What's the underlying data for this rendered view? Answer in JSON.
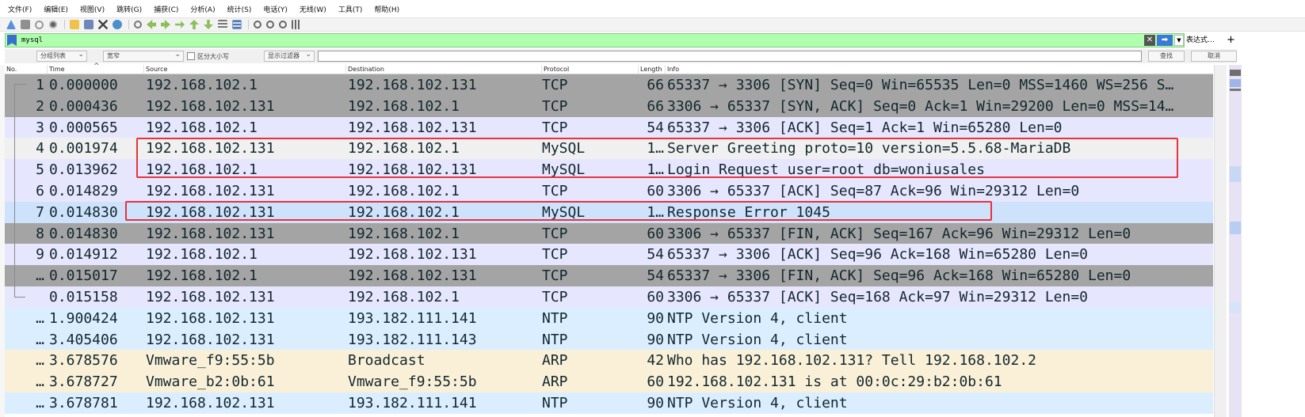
{
  "menu": [
    "文件(F)",
    "编辑(E)",
    "视图(V)",
    "跳转(G)",
    "捕获(C)",
    "分析(A)",
    "统计(S)",
    "电话(Y)",
    "无线(W)",
    "工具(T)",
    "帮助(H)"
  ],
  "filter": {
    "value": "mysql",
    "clear_icon": "✕",
    "apply_icon": "➡",
    "expression_label": "表达式…",
    "plus_label": "+"
  },
  "find": {
    "search_in": "分组列表",
    "string_type": "宽窄",
    "case_label": "区分大小写",
    "mode": "显示过滤器",
    "find_button": "查找",
    "cancel_button": "取消"
  },
  "columns": {
    "no": "No.",
    "time": "Time",
    "source": "Source",
    "destination": "Destination",
    "protocol": "Protocol",
    "length": "Length",
    "info": "Info",
    "sort_caret": "^"
  },
  "packets": [
    {
      "no": "1",
      "time": "0.000000",
      "source": "192.168.102.1",
      "destination": "192.168.102.131",
      "protocol": "TCP",
      "length": "66",
      "info": "65337 → 3306 [SYN] Seq=0 Win=65535 Len=0 MSS=1460 WS=256 S…",
      "bg": "#a4a4a4"
    },
    {
      "no": "2",
      "time": "0.000436",
      "source": "192.168.102.131",
      "destination": "192.168.102.1",
      "protocol": "TCP",
      "length": "66",
      "info": "3306 → 65337 [SYN, ACK] Seq=0 Ack=1 Win=29200 Len=0 MSS=14…",
      "bg": "#a4a4a4"
    },
    {
      "no": "3",
      "time": "0.000565",
      "source": "192.168.102.1",
      "destination": "192.168.102.131",
      "protocol": "TCP",
      "length": "54",
      "info": "65337 → 3306 [ACK] Seq=1 Ack=1 Win=65280 Len=0",
      "bg": "#e7e6ff"
    },
    {
      "no": "4",
      "time": "0.001974",
      "source": "192.168.102.131",
      "destination": "192.168.102.1",
      "protocol": "MySQL",
      "length": "1…",
      "info": "Server Greeting proto=10 version=5.5.68-MariaDB",
      "bg": "#f0f0f0"
    },
    {
      "no": "5",
      "time": "0.013962",
      "source": "192.168.102.1",
      "destination": "192.168.102.131",
      "protocol": "MySQL",
      "length": "1…",
      "info": "Login Request user=root db=woniusales",
      "bg": "#e7e6ff"
    },
    {
      "no": "6",
      "time": "0.014829",
      "source": "192.168.102.131",
      "destination": "192.168.102.1",
      "protocol": "TCP",
      "length": "60",
      "info": "3306 → 65337 [ACK] Seq=87 Ack=96 Win=29312 Len=0",
      "bg": "#e7e6ff"
    },
    {
      "no": "7",
      "time": "0.014830",
      "source": "192.168.102.131",
      "destination": "192.168.102.1",
      "protocol": "MySQL",
      "length": "1…",
      "info": "Response Error 1045",
      "bg": "#cfe2fb"
    },
    {
      "no": "8",
      "time": "0.014830",
      "source": "192.168.102.131",
      "destination": "192.168.102.1",
      "protocol": "TCP",
      "length": "60",
      "info": "3306 → 65337 [FIN, ACK] Seq=167 Ack=96 Win=29312 Len=0",
      "bg": "#a4a4a4"
    },
    {
      "no": "9",
      "time": "0.014912",
      "source": "192.168.102.1",
      "destination": "192.168.102.131",
      "protocol": "TCP",
      "length": "54",
      "info": "65337 → 3306 [ACK] Seq=96 Ack=168 Win=65280 Len=0",
      "bg": "#e7e6ff"
    },
    {
      "no": "…",
      "time": "0.015017",
      "source": "192.168.102.1",
      "destination": "192.168.102.131",
      "protocol": "TCP",
      "length": "54",
      "info": "65337 → 3306 [FIN, ACK] Seq=96 Ack=168 Win=65280 Len=0",
      "bg": "#a4a4a4"
    },
    {
      "no": "",
      "time": "0.015158",
      "source": "192.168.102.131",
      "destination": "192.168.102.1",
      "protocol": "TCP",
      "length": "60",
      "info": "3306 → 65337 [ACK] Seq=168 Ack=97 Win=29312 Len=0",
      "bg": "#e7e6ff"
    },
    {
      "no": "…",
      "time": "1.900424",
      "source": "192.168.102.131",
      "destination": "193.182.111.141",
      "protocol": "NTP",
      "length": "90",
      "info": "NTP Version 4, client",
      "bg": "#daeeff"
    },
    {
      "no": "…",
      "time": "3.405406",
      "source": "192.168.102.131",
      "destination": "193.182.111.143",
      "protocol": "NTP",
      "length": "90",
      "info": "NTP Version 4, client",
      "bg": "#daeeff"
    },
    {
      "no": "…",
      "time": "3.678576",
      "source": "Vmware_f9:55:5b",
      "destination": "Broadcast",
      "protocol": "ARP",
      "length": "42",
      "info": "Who has 192.168.102.131? Tell 192.168.102.2",
      "bg": "#faf0d7"
    },
    {
      "no": "…",
      "time": "3.678727",
      "source": "Vmware_b2:0b:61",
      "destination": "Vmware_f9:55:5b",
      "protocol": "ARP",
      "length": "60",
      "info": "192.168.102.131 is at 00:0c:29:b2:0b:61",
      "bg": "#faf0d7"
    },
    {
      "no": "…",
      "time": "3.678781",
      "source": "192.168.102.131",
      "destination": "193.182.111.141",
      "protocol": "NTP",
      "length": "90",
      "info": "NTP Version 4, client",
      "bg": "#daeeff"
    }
  ],
  "colors": {
    "highlight_box": "#e8323c",
    "filter_ok": "#afffaf"
  },
  "toolbar_icons": [
    "shark-fin-icon",
    "stop-icon",
    "restart-icon",
    "options-icon",
    "open-icon",
    "save-icon",
    "close-icon",
    "reload-icon",
    "find-icon",
    "back-icon",
    "forward-icon",
    "goto-icon",
    "first-icon",
    "last-icon",
    "autoscroll-icon",
    "colorize-icon",
    "zoom-in-icon",
    "zoom-out-icon",
    "zoom-reset-icon",
    "resize-columns-icon"
  ]
}
